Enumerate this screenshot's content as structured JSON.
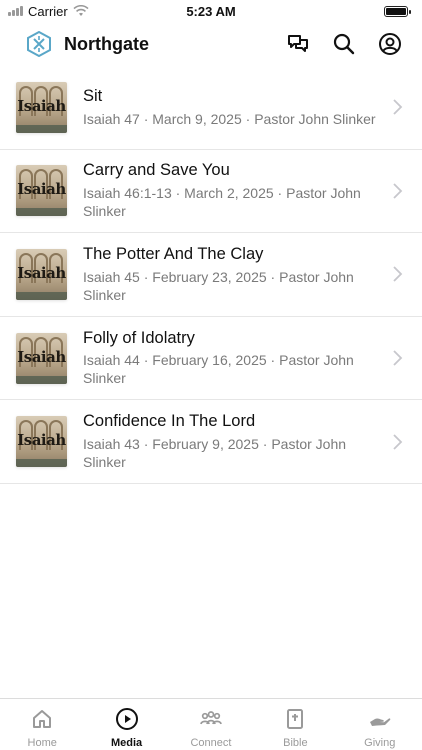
{
  "status_bar": {
    "carrier": "Carrier",
    "time": "5:23 AM"
  },
  "header": {
    "title": "Northgate",
    "icons": [
      "logo-icon",
      "chat-icon",
      "search-icon",
      "profile-icon"
    ],
    "accent_color": "#5aa7c8"
  },
  "sermons": [
    {
      "title": "Sit",
      "subtitle": "Isaiah 47 · March 9, 2025 · Pastor John Slinker",
      "thumb_text": "Isaiah"
    },
    {
      "title": "Carry and Save You",
      "subtitle": "Isaiah 46:1-13 · March 2, 2025 · Pastor John Slinker",
      "thumb_text": "Isaiah"
    },
    {
      "title": "The Potter And The Clay",
      "subtitle": "Isaiah 45 · February 23, 2025 · Pastor John Slinker",
      "thumb_text": "Isaiah"
    },
    {
      "title": "Folly of Idolatry",
      "subtitle": "Isaiah 44 · February 16, 2025 · Pastor John Slinker",
      "thumb_text": "Isaiah"
    },
    {
      "title": "Confidence In The Lord",
      "subtitle": "Isaiah 43 · February 9, 2025 · Pastor John Slinker",
      "thumb_text": "Isaiah"
    }
  ],
  "tabs": [
    {
      "label": "Home",
      "icon": "home-icon",
      "active": false
    },
    {
      "label": "Media",
      "icon": "play-circle-icon",
      "active": true
    },
    {
      "label": "Connect",
      "icon": "people-icon",
      "active": false
    },
    {
      "label": "Bible",
      "icon": "bible-icon",
      "active": false
    },
    {
      "label": "Giving",
      "icon": "giving-hand-icon",
      "active": false
    }
  ]
}
